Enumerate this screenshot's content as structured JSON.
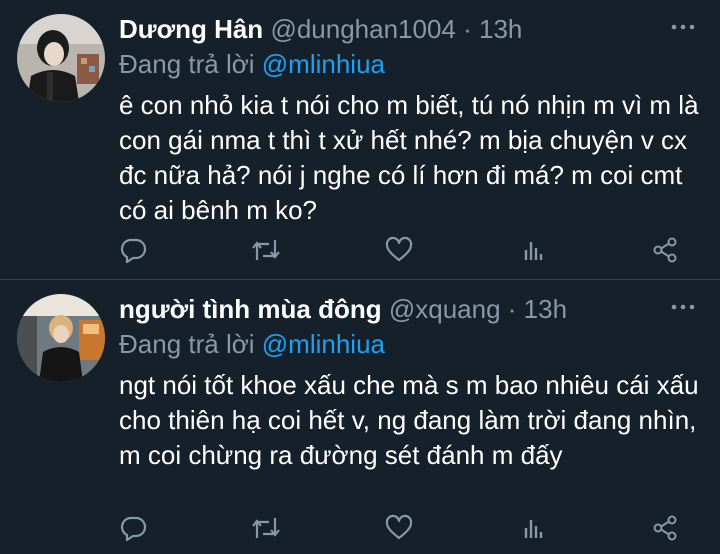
{
  "tweets": [
    {
      "display_name": "Dương Hân",
      "handle": "@dunghan1004",
      "separator": " · ",
      "time": "13h",
      "replying_prefix": "Đang trả lời ",
      "replying_to": "@mlinhiua",
      "text": "ê con nhỏ kia t nói cho m biết, tú nó nhịn m vì m là con gái nma t thì t xử hết nhé? m bịa chuyện v cx đc nữa hả? nói j nghe có lí hơn đi má? m coi cmt có ai bênh m ko?"
    },
    {
      "display_name": "người tình mùa đông",
      "handle": "@xquang",
      "separator": " · ",
      "time": "13h",
      "replying_prefix": "Đang trả lời ",
      "replying_to": "@mlinhiua",
      "text": "ngt nói tốt khoe xấu che mà s m bao nhiêu cái xấu cho thiên hạ coi hết v, ng đang làm trời đang nhìn, m coi chừng ra đường sét đánh m đấy"
    }
  ],
  "icons": [
    "reply-icon",
    "retweet-icon",
    "like-icon",
    "analytics-icon",
    "share-icon",
    "more-icon"
  ],
  "colors": {
    "background": "#15202b",
    "divider": "#38444d",
    "secondary_text": "#8899a6",
    "accent": "#1da1f2",
    "primary_text": "#ffffff"
  }
}
